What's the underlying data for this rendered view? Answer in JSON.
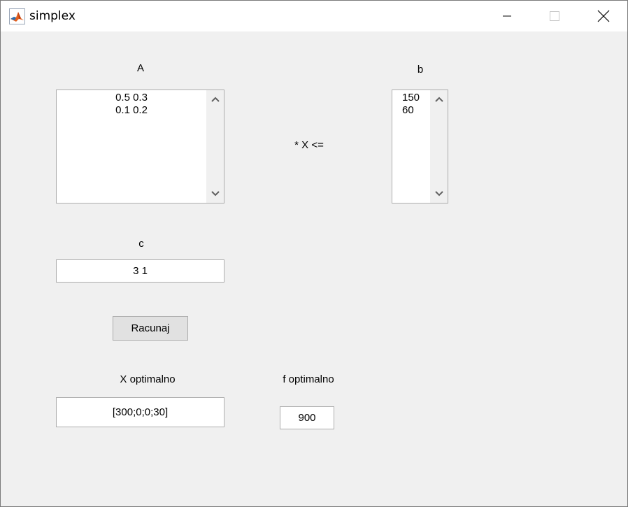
{
  "window": {
    "title": "simplex",
    "icon": "matlab-icon"
  },
  "labels": {
    "a": "A",
    "b": "b",
    "operator": "* X <=",
    "c": "c",
    "x_opt": "X optimalno",
    "f_opt": "f optimalno"
  },
  "a_list": {
    "lines": [
      "0.5 0.3",
      "0.1 0.2"
    ]
  },
  "b_list": {
    "lines": [
      "150",
      "60"
    ]
  },
  "c_field": {
    "value": "3 1"
  },
  "compute_button": {
    "label": "Racunaj"
  },
  "x_result": {
    "value": "[300;0;0;30]"
  },
  "f_result": {
    "value": "900"
  },
  "colors": {
    "window_bg": "#f0f0f0",
    "titlebar_bg": "#ffffff",
    "border": "#adadad"
  }
}
